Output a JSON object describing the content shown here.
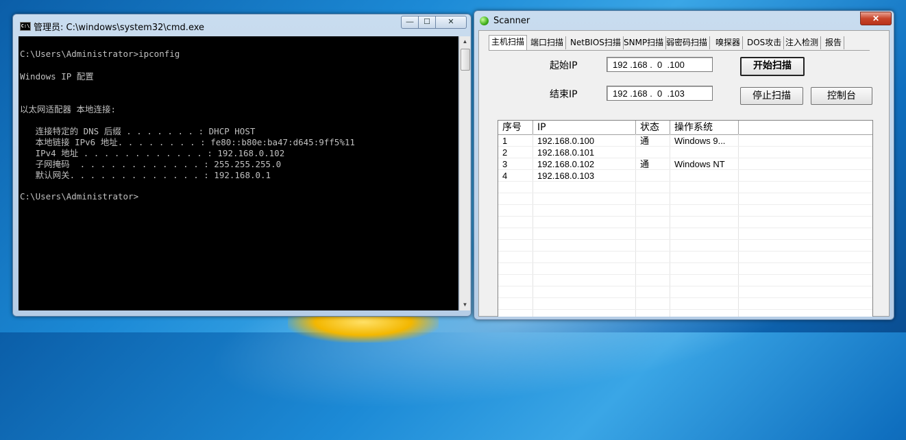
{
  "cmd": {
    "title": "管理员: C:\\windows\\system32\\cmd.exe",
    "icon_text": "C:\\",
    "controls": {
      "minimize": "—",
      "maximize": "☐",
      "close": "✕"
    },
    "lines": [
      "C:\\Users\\Administrator>ipconfig",
      "Windows IP 配置",
      "以太网适配器 本地连接:",
      "   连接特定的 DNS 后缀 . . . . . . . : DHCP HOST",
      "   本地链接 IPv6 地址. . . . . . . . : fe80::b80e:ba47:d645:9ff5%11",
      "   IPv4 地址 . . . . . . . . . . . . : 192.168.0.102",
      "   子网掩码  . . . . . . . . . . . . : 255.255.255.0",
      "   默认网关. . . . . . . . . . . . . : 192.168.0.1",
      "C:\\Users\\Administrator>"
    ],
    "scroll": {
      "up": "▲",
      "down": "▼"
    }
  },
  "scanner": {
    "title": "Scanner",
    "close": "✕",
    "tabs": [
      "主机扫描",
      "端口扫描",
      "NetBIOS扫描",
      "SNMP扫描",
      "弱密码扫描",
      "嗅探器",
      "DOS攻击",
      "注入检测",
      "报告"
    ],
    "start_ip_label": "起始IP",
    "end_ip_label": "结束IP",
    "start_ip": "192 .168 .  0  .100",
    "end_ip": "192 .168 .  0  .103",
    "start_scan": "开始扫描",
    "stop_scan": "停止扫描",
    "console": "控制台",
    "table": {
      "headers": [
        "序号",
        "IP",
        "状态",
        "操作系统"
      ],
      "rows": [
        [
          "1",
          "192.168.0.100",
          "通",
          "Windows 9..."
        ],
        [
          "2",
          "192.168.0.101",
          "",
          ""
        ],
        [
          "3",
          "192.168.0.102",
          "通",
          "Windows NT"
        ],
        [
          "4",
          "192.168.0.103",
          "",
          ""
        ]
      ]
    }
  }
}
